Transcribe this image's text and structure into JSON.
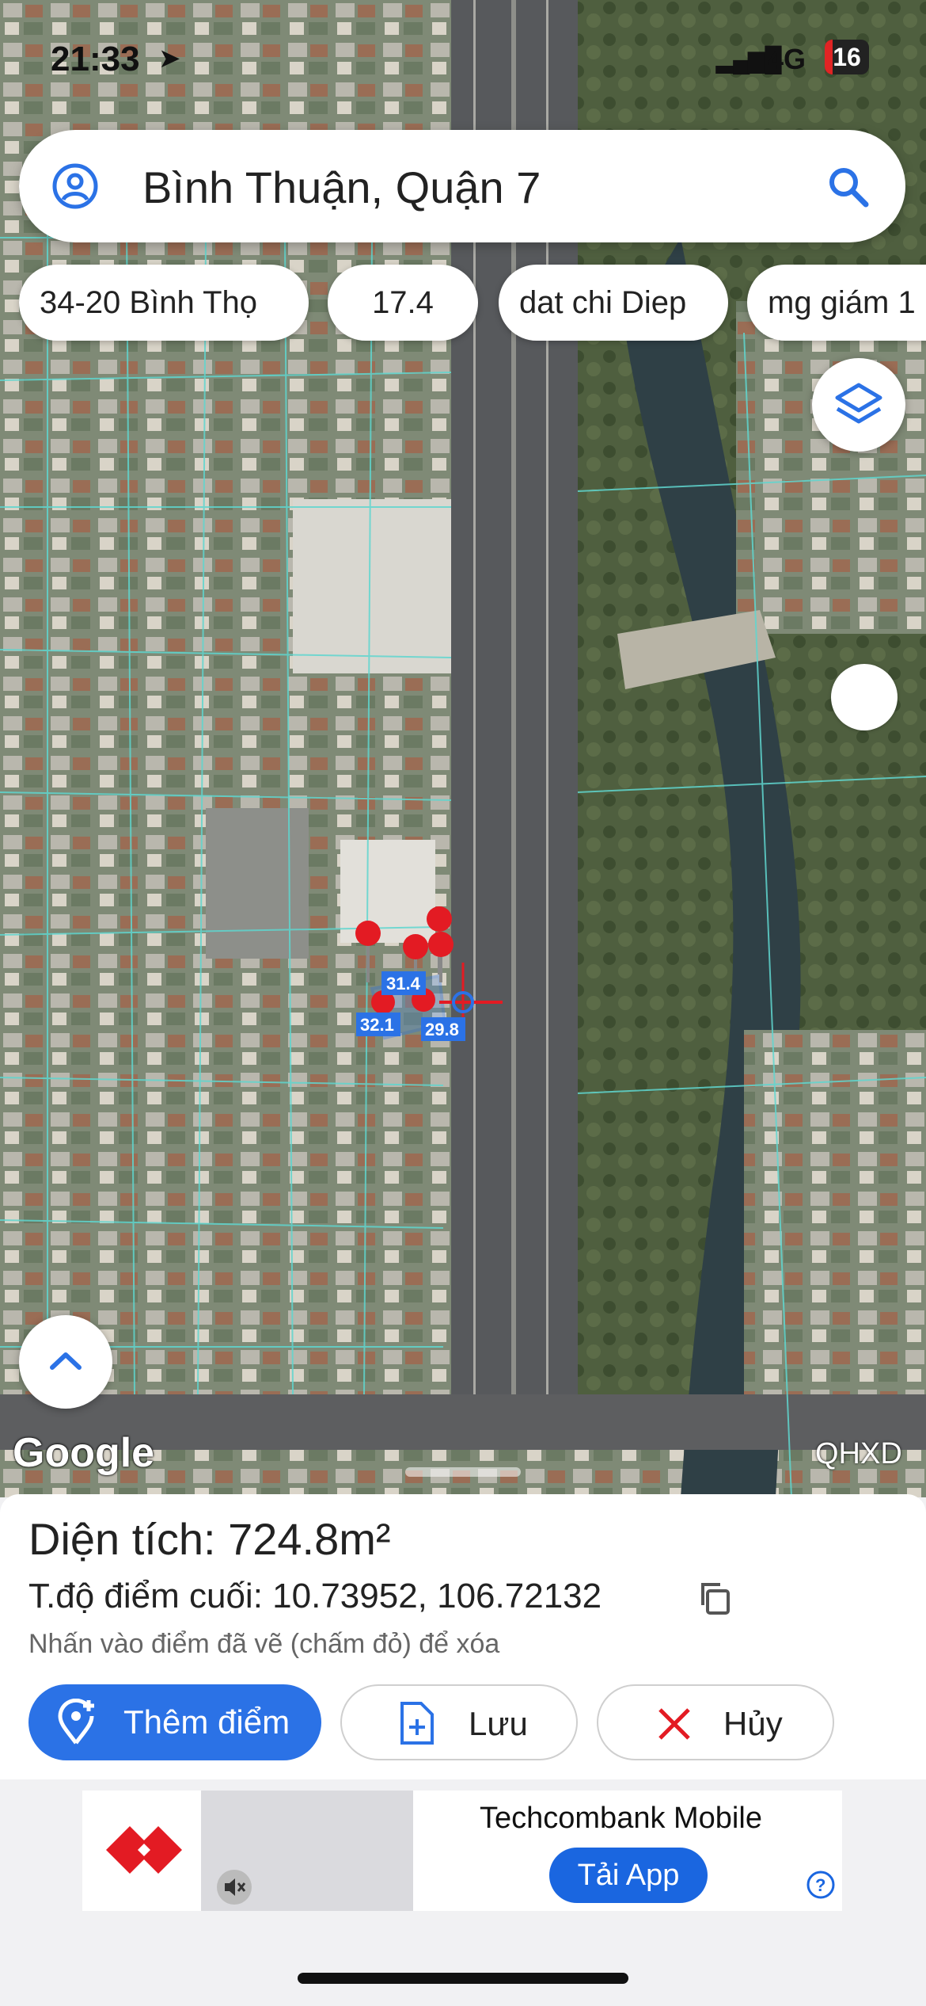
{
  "status_bar": {
    "time": "21:33",
    "network": "4G",
    "battery": "16"
  },
  "search": {
    "query": "Bình Thuận, Quận 7"
  },
  "chips": [
    "34-20 Bình Thọ",
    "17.4",
    "dat chi Diep",
    "mg giám 1"
  ],
  "map": {
    "attribution": "Google",
    "layer_label": "QHXD",
    "measurements": [
      "31.4",
      "32.1",
      "29.8"
    ]
  },
  "panel": {
    "area": "Diện tích: 724.8m²",
    "coords": "T.độ điểm cuối: 10.73952, 106.72132",
    "hint": "Nhấn vào điểm đã vẽ (chấm đỏ) để xóa",
    "add_label": "Thêm điểm",
    "save_label": "Lưu",
    "cancel_label": "Hủy"
  },
  "ad": {
    "title": "Techcombank Mobile",
    "cta": "Tải App"
  },
  "colors": {
    "accent": "#2b72e6",
    "marker": "#e31b23",
    "parcel_lines": "#5fd6cf"
  }
}
